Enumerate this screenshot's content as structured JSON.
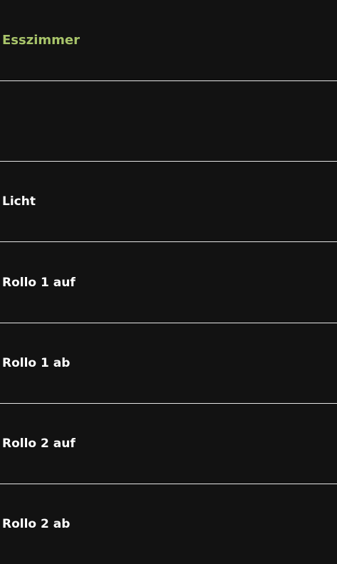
{
  "room": {
    "title": "Esszimmer",
    "title_color": "#a8c46a"
  },
  "items": [
    {
      "label": ""
    },
    {
      "label": "Licht"
    },
    {
      "label": "Rollo 1 auf"
    },
    {
      "label": "Rollo 1 ab"
    },
    {
      "label": "Rollo 2 auf"
    },
    {
      "label": "Rollo 2 ab"
    }
  ]
}
